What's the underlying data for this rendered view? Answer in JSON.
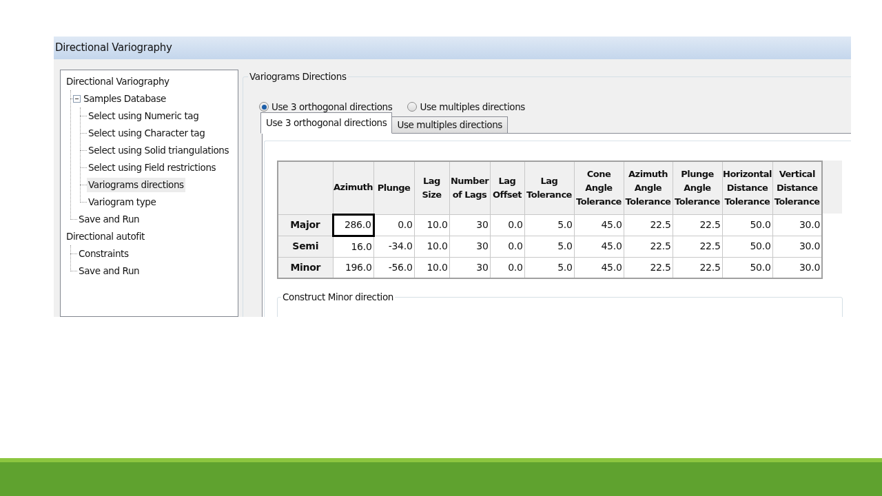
{
  "window": {
    "title": "Directional Variography"
  },
  "tree": [
    {
      "label": "Directional Variography",
      "selected": false,
      "children": [
        {
          "label": "Samples Database",
          "selected": false,
          "expanded": true,
          "children": [
            {
              "label": "Select using Numeric tag",
              "selected": false
            },
            {
              "label": "Select using Character tag",
              "selected": false
            },
            {
              "label": "Select using Solid triangulations",
              "selected": false
            },
            {
              "label": "Select using Field restrictions",
              "selected": false
            },
            {
              "label": "Variograms directions",
              "selected": true
            },
            {
              "label": "Variogram type",
              "selected": false
            }
          ]
        },
        {
          "label": "Save and Run",
          "selected": false
        }
      ]
    },
    {
      "label": "Directional autofit",
      "selected": false,
      "children": [
        {
          "label": "Constraints",
          "selected": false
        },
        {
          "label": "Save and Run",
          "selected": false
        }
      ]
    }
  ],
  "group": {
    "title": "Variograms Directions"
  },
  "radios": [
    {
      "label": "Use 3 orthogonal directions",
      "selected": true
    },
    {
      "label": "Use multiples directions",
      "selected": false
    }
  ],
  "tabs": [
    {
      "label": "Use 3 orthogonal directions",
      "selected": true
    },
    {
      "label": "Use multiples directions",
      "selected": false
    }
  ],
  "table": {
    "columns": [
      "Azimuth",
      "Plunge",
      "Lag Size",
      "Number of Lags",
      "Lag Offset",
      "Lag Tolerance",
      "Cone Angle Tolerance",
      "Azimuth Angle Tolerance",
      "Plunge Angle Tolerance",
      "Horizontal Distance Tolerance",
      "Vertical Distance Tolerance"
    ],
    "rows": [
      {
        "header": "Major",
        "cells": [
          {
            "text": "286.0",
            "focused": true
          },
          {
            "text": "0.0",
            "focused": false
          },
          {
            "text": "10.0",
            "focused": false
          },
          {
            "text": "30",
            "focused": false
          },
          {
            "text": "0.0",
            "focused": false
          },
          {
            "text": "5.0",
            "focused": false
          },
          {
            "text": "45.0",
            "focused": false
          },
          {
            "text": "22.5",
            "focused": false
          },
          {
            "text": "22.5",
            "focused": false
          },
          {
            "text": "50.0",
            "focused": false
          },
          {
            "text": "30.0",
            "focused": false
          }
        ]
      },
      {
        "header": "Semi",
        "cells": [
          {
            "text": "16.0",
            "focused": false
          },
          {
            "text": "-34.0",
            "focused": false
          },
          {
            "text": "10.0",
            "focused": false
          },
          {
            "text": "30",
            "focused": false
          },
          {
            "text": "0.0",
            "focused": false
          },
          {
            "text": "5.0",
            "focused": false
          },
          {
            "text": "45.0",
            "focused": false
          },
          {
            "text": "22.5",
            "focused": false
          },
          {
            "text": "22.5",
            "focused": false
          },
          {
            "text": "50.0",
            "focused": false
          },
          {
            "text": "30.0",
            "focused": false
          }
        ]
      },
      {
        "header": "Minor",
        "cells": [
          {
            "text": "196.0",
            "focused": false
          },
          {
            "text": "-56.0",
            "focused": false
          },
          {
            "text": "10.0",
            "focused": false
          },
          {
            "text": "30",
            "focused": false
          },
          {
            "text": "0.0",
            "focused": false
          },
          {
            "text": "5.0",
            "focused": false
          },
          {
            "text": "45.0",
            "focused": false
          },
          {
            "text": "22.5",
            "focused": false
          },
          {
            "text": "22.5",
            "focused": false
          },
          {
            "text": "50.0",
            "focused": false
          },
          {
            "text": "30.0",
            "focused": false
          }
        ]
      }
    ]
  },
  "subgroup": {
    "title": "Construct Minor direction"
  }
}
